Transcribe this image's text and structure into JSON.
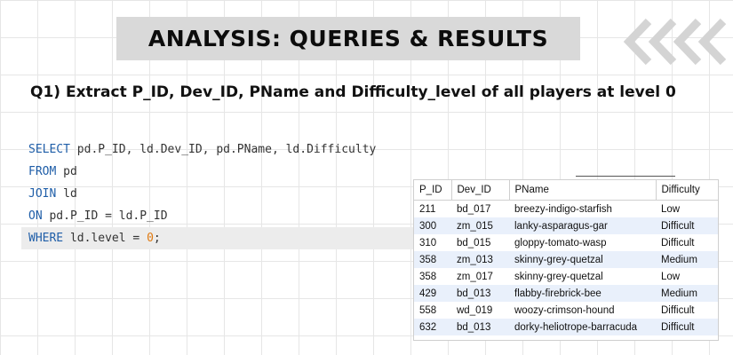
{
  "banner": {
    "title": "ANALYSIS: QUERIES & RESULTS"
  },
  "question": {
    "text": "Q1) Extract P_ID, Dev_ID, PName and Difficulty_level of all players at level 0"
  },
  "query": {
    "lines": [
      {
        "keyword": "SELECT",
        "rest": " pd.P_ID, ld.Dev_ID, pd.PName, ld.Difficulty"
      },
      {
        "keyword": "FROM",
        "rest": " pd"
      },
      {
        "keyword": "JOIN",
        "rest": " ld"
      },
      {
        "keyword": "ON",
        "rest": " pd.P_ID = ld.P_ID"
      },
      {
        "keyword": "WHERE",
        "rest": " ld.level = ",
        "number": "0",
        "end": ";"
      }
    ]
  },
  "result": {
    "columns": [
      "P_ID",
      "Dev_ID",
      "PName",
      "Difficulty"
    ],
    "rows": [
      [
        "211",
        "bd_017",
        "breezy-indigo-starfish",
        "Low"
      ],
      [
        "300",
        "zm_015",
        "lanky-asparagus-gar",
        "Difficult"
      ],
      [
        "310",
        "bd_015",
        "gloppy-tomato-wasp",
        "Difficult"
      ],
      [
        "358",
        "zm_013",
        "skinny-grey-quetzal",
        "Medium"
      ],
      [
        "358",
        "zm_017",
        "skinny-grey-quetzal",
        "Low"
      ],
      [
        "429",
        "bd_013",
        "flabby-firebrick-bee",
        "Medium"
      ],
      [
        "558",
        "wd_019",
        "woozy-crimson-hound",
        "Difficult"
      ],
      [
        "632",
        "bd_013",
        "dorky-heliotrope-barracuda",
        "Difficult"
      ]
    ]
  },
  "colors": {
    "keyword": "#1f5ea8",
    "number": "#e07a10",
    "row_stripe": "#e9f0fb",
    "banner_bg": "#d9d9d9"
  },
  "icons": [
    "chevrons-left-icon"
  ]
}
